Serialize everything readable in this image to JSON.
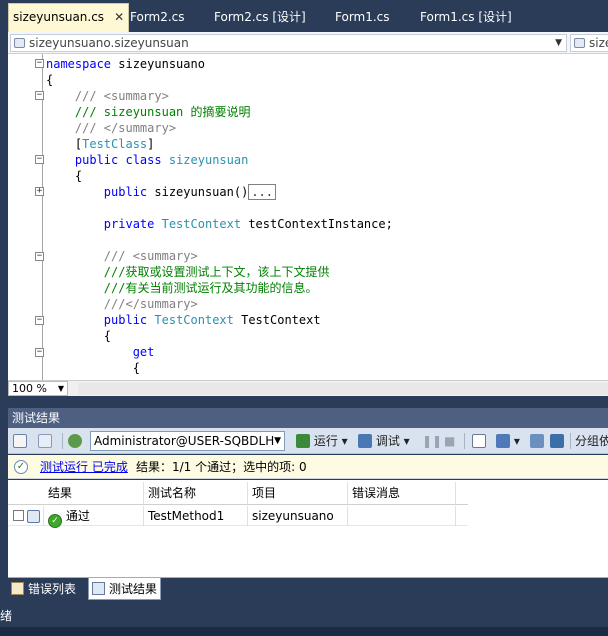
{
  "tabs": [
    {
      "label": "sizeyunsuan.cs",
      "active": true
    },
    {
      "label": "Form2.cs"
    },
    {
      "label": "Form2.cs [设计]"
    },
    {
      "label": "Form1.cs"
    },
    {
      "label": "Form1.cs [设计]"
    }
  ],
  "nav": {
    "left_combo": "sizeyunsuano.sizeyunsuan",
    "right_combo": "size"
  },
  "code": [
    "namespace sizeyunsuano",
    "{",
    "    /// <summary>",
    "    /// sizeyunsuan 的摘要说明",
    "    /// </summary>",
    "    [TestClass]",
    "    public class sizeyunsuan",
    "    {",
    "        public sizeyunsuan()...",
    "",
    "        private TestContext testContextInstance;",
    "",
    "        /// <summary>",
    "        ///获取或设置测试上下文，该上下文提供",
    "        ///有关当前测试运行及其功能的信息。",
    "        ///</summary>",
    "        public TestContext TestContext",
    "        {",
    "            get",
    "            {"
  ],
  "zoom": "100 %",
  "panel": {
    "title": "测试结果",
    "user_combo": "Administrator@USER-SQBDLH",
    "run_label": "运行",
    "debug_label": "调试",
    "group_label": "分组依"
  },
  "status": {
    "link": "测试运行 已完成",
    "summary": "结果：1/1 个通过；选中的项: 0"
  },
  "results": {
    "headers": [
      "结果",
      "测试名称",
      "项目",
      "错误消息"
    ],
    "rows": [
      {
        "result": "通过",
        "name": "TestMethod1",
        "project": "sizeyunsuano",
        "error": ""
      }
    ]
  },
  "bottom_tabs": [
    "错误列表",
    "测试结果"
  ],
  "statusbar": "绪"
}
